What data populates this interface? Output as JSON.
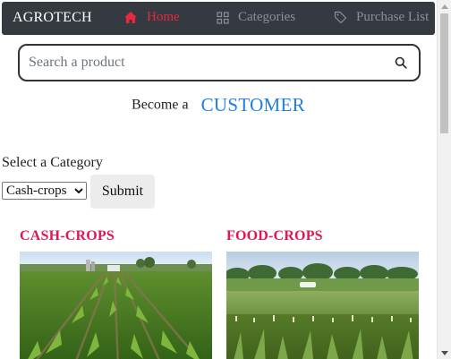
{
  "navbar": {
    "brand": "AGROTECH",
    "items": [
      {
        "label": "Home",
        "icon": "home-icon",
        "active": true
      },
      {
        "label": "Categories",
        "icon": "grid-icon",
        "active": false
      },
      {
        "label": "Purchase List",
        "icon": "tag-icon",
        "active": false
      }
    ],
    "colors": {
      "background": "#343a40",
      "active": "#e7283f",
      "inactive": "#8b9096"
    }
  },
  "search": {
    "placeholder": "Search a product",
    "value": "",
    "icon": "search-icon"
  },
  "become": {
    "text": "Become a",
    "link_label": "CUSTOMER",
    "link_color": "#1d7fe4"
  },
  "category_form": {
    "label": "Select a Category",
    "selected": "Cash-crops",
    "submit_label": "Submit"
  },
  "cards": [
    {
      "title": "CASH-CROPS",
      "image": "cornfield-rows-photo"
    },
    {
      "title": "FOOD-CROPS",
      "image": "field-with-trees-photo"
    }
  ],
  "accent_color": "#e0174f"
}
